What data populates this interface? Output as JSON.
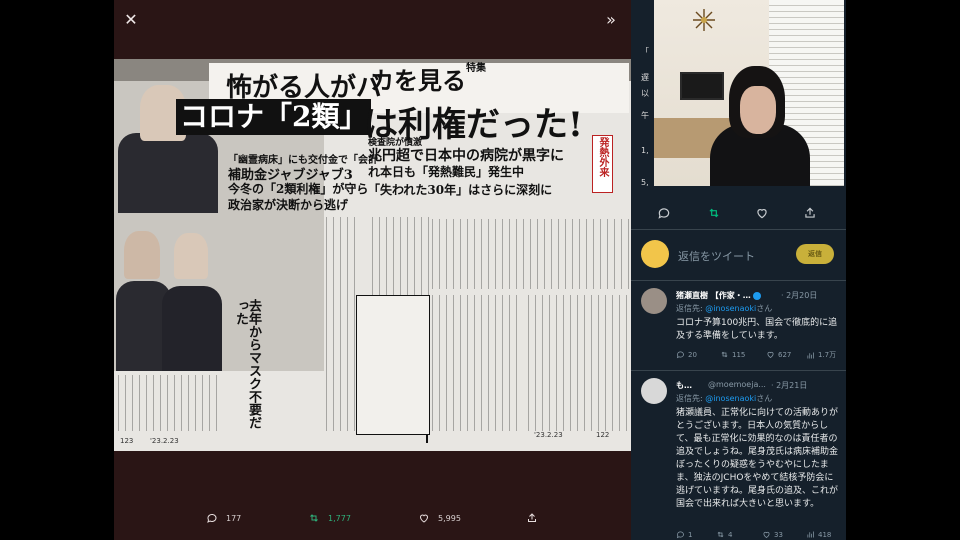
{
  "viewer": {
    "close_icon": "close-icon",
    "collapse_icon": "double-chevron-right-icon",
    "actions": {
      "reply_count": "177",
      "retweet_count": "1,777",
      "like_count": "5,995"
    }
  },
  "magazine": {
    "headline_top": "怖がる人がバ",
    "headline_top2": "カを見る",
    "tokushu": "特集",
    "headline_main": "コロナ「2類」",
    "headline_main2": "は利権だった!",
    "sub_lines": [
      "「幽霊病床」にも交付金で「会計",
      "補助金ジャブジャブ3",
      "今冬の「2類利権」が守ら",
      "政治家が決断から逃げ"
    ],
    "right_lines": [
      "検査院が憤激",
      "兆円超で日本中の病院が黒字に",
      "れ本日も「発熱難民」発生中",
      "「失われた30年」はさらに深刻に"
    ],
    "red_box": "発熱外来",
    "vertical_title": "去年からマスク不要だった",
    "page_left": "'23.2.23",
    "page_right": "'23.2.23",
    "page_left_num": "123",
    "page_right_num": "122"
  },
  "thread": {
    "strip_texts": [
      "「",
      "遅",
      "以",
      "午",
      "1,",
      "5,"
    ],
    "reply_placeholder": "返信をツイート",
    "reply_button": "返信",
    "tweets": [
      {
        "name": "猪瀬直樹 【作家・…",
        "date": "· 2月20日",
        "reply_to_prefix": "返信先:",
        "reply_to_handle": "@inosenaoki",
        "reply_to_suffix": "さん",
        "body": "コロナ予算100兆円、国会で徹底的に追及する準備をしています。",
        "stats": [
          "20",
          "115",
          "627",
          "1.7万"
        ]
      },
      {
        "name": "も…",
        "handle": "@moemoeja...",
        "date": "· 2月21日",
        "reply_to_prefix": "返信先:",
        "reply_to_handle": "@inosenaoki",
        "reply_to_suffix": "さん",
        "body": "猪瀬議員、正常化に向けての活動ありがとうございます。日本人の気質からして、最も正常化に効果的なのは責任者の追及でしょうね。尾身茂氏は病床補助金ぼったくりの疑惑をうやむやにしたまま、独法のJCHOをやめて結核予防会に逃げていますね。尾身氏の追及、これが国会で出来れば大きいと思います。",
        "stats": [
          "1",
          "4",
          "33",
          "418"
        ]
      }
    ]
  },
  "colors": {
    "viewer_bg": "#2a1515",
    "thread_bg": "#15202b",
    "link_blue": "#1d9bf0",
    "retweet_green": "#00ba7c"
  }
}
